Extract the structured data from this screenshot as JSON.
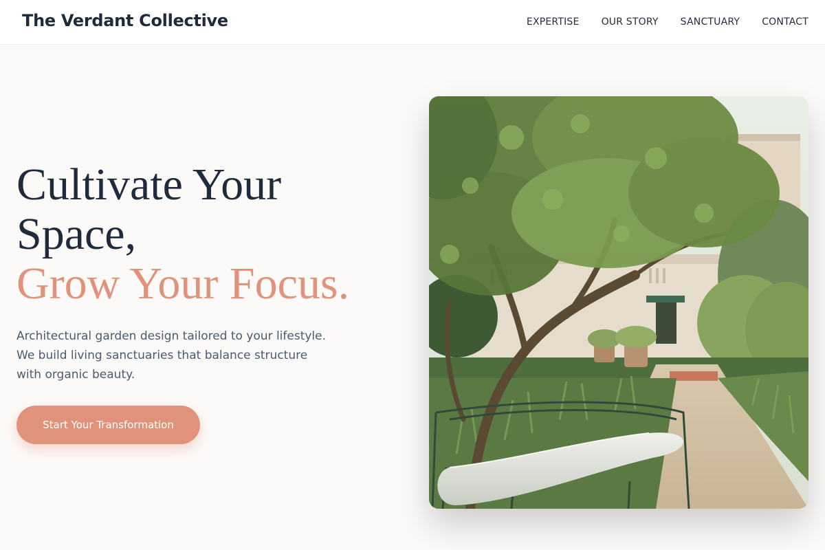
{
  "header": {
    "brand": "The Verdant Collective",
    "nav": [
      "EXPERTISE",
      "OUR STORY",
      "SANCTUARY",
      "CONTACT"
    ]
  },
  "hero": {
    "title_line1": "Cultivate Your",
    "title_line2": "Space,",
    "title_accent": "Grow Your Focus.",
    "description": "Architectural garden design tailored to your lifestyle. We build living sanctuaries that balance structure with organic beauty.",
    "cta_label": "Start Your Transformation"
  },
  "image": {
    "subject": "garden-courtyard-with-bench"
  },
  "colors": {
    "accent": "#e0927a",
    "text_dark": "#1f2a3d",
    "text_muted": "#4a5a6e",
    "background": "#fcfaf8"
  }
}
